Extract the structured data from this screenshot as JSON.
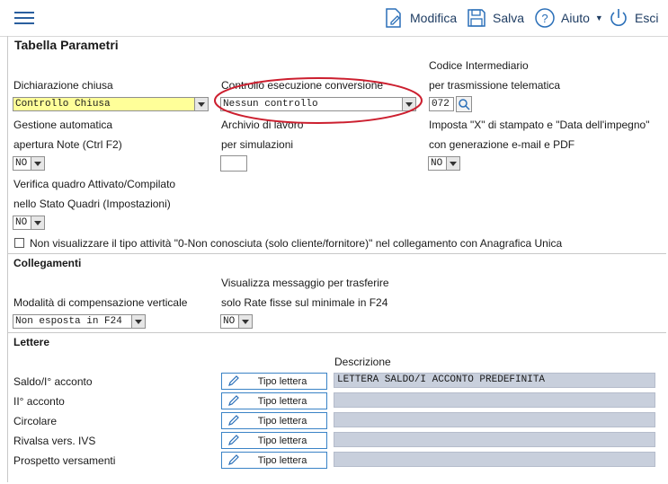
{
  "toolbar": {
    "modifica": "Modifica",
    "salva": "Salva",
    "aiuto": "Aiuto",
    "esci": "Esci"
  },
  "page_title": "Tabella Parametri",
  "fields": {
    "dichiarazione_label": "Dichiarazione chiusa",
    "dichiarazione_value": "Controllo Chiusa",
    "controllo_label": "Controllo esecuzione conversione",
    "controllo_value": "Nessun controllo",
    "codice_label_1": "Codice Intermediario",
    "codice_label_2": "per trasmissione telematica",
    "codice_value": "072",
    "gestione_label_1": "Gestione automatica",
    "gestione_label_2": "apertura Note (Ctrl F2)",
    "gestione_value": "NO",
    "archivio_label_1": "Archivio di lavoro",
    "archivio_label_2": "per simulazioni",
    "archivio_value": "",
    "imposta_label_1": "Imposta \"X\" di stampato e \"Data dell'impegno\"",
    "imposta_label_2": "con generazione e-mail e PDF",
    "imposta_value": "NO",
    "verifica_label_1": "Verifica quadro Attivato/Compilato",
    "verifica_label_2": "nello Stato Quadri (Impostazioni)",
    "verifica_value": "NO",
    "checkbox_label": "Non visualizzare il tipo attività \"0-Non conosciuta (solo cliente/fornitore)\" nel collegamento con Anagrafica Unica"
  },
  "collegamenti": {
    "title": "Collegamenti",
    "modalita_label": "Modalità di compensazione verticale",
    "modalita_value": "Non esposta in F24",
    "visualizza_label_1": "Visualizza messaggio per trasferire",
    "visualizza_label_2": "solo Rate fisse sul minimale in F24",
    "visualizza_value": "NO"
  },
  "lettere": {
    "title": "Lettere",
    "descrizione_header": "Descrizione",
    "button_label": "Tipo lettera",
    "rows": [
      {
        "label": "Saldo/I° acconto",
        "desc": "LETTERA SALDO/I ACCONTO PREDEFINITA"
      },
      {
        "label": "II° acconto",
        "desc": ""
      },
      {
        "label": "Circolare",
        "desc": ""
      },
      {
        "label": "Rivalsa vers. IVS",
        "desc": ""
      },
      {
        "label": "Prospetto versamenti",
        "desc": ""
      }
    ]
  },
  "colors": {
    "accent": "#1f3d63",
    "highlight_yellow": "#ffff99",
    "annotation_red": "#cc1f2f",
    "desc_field_bg": "#c8cfdc"
  }
}
